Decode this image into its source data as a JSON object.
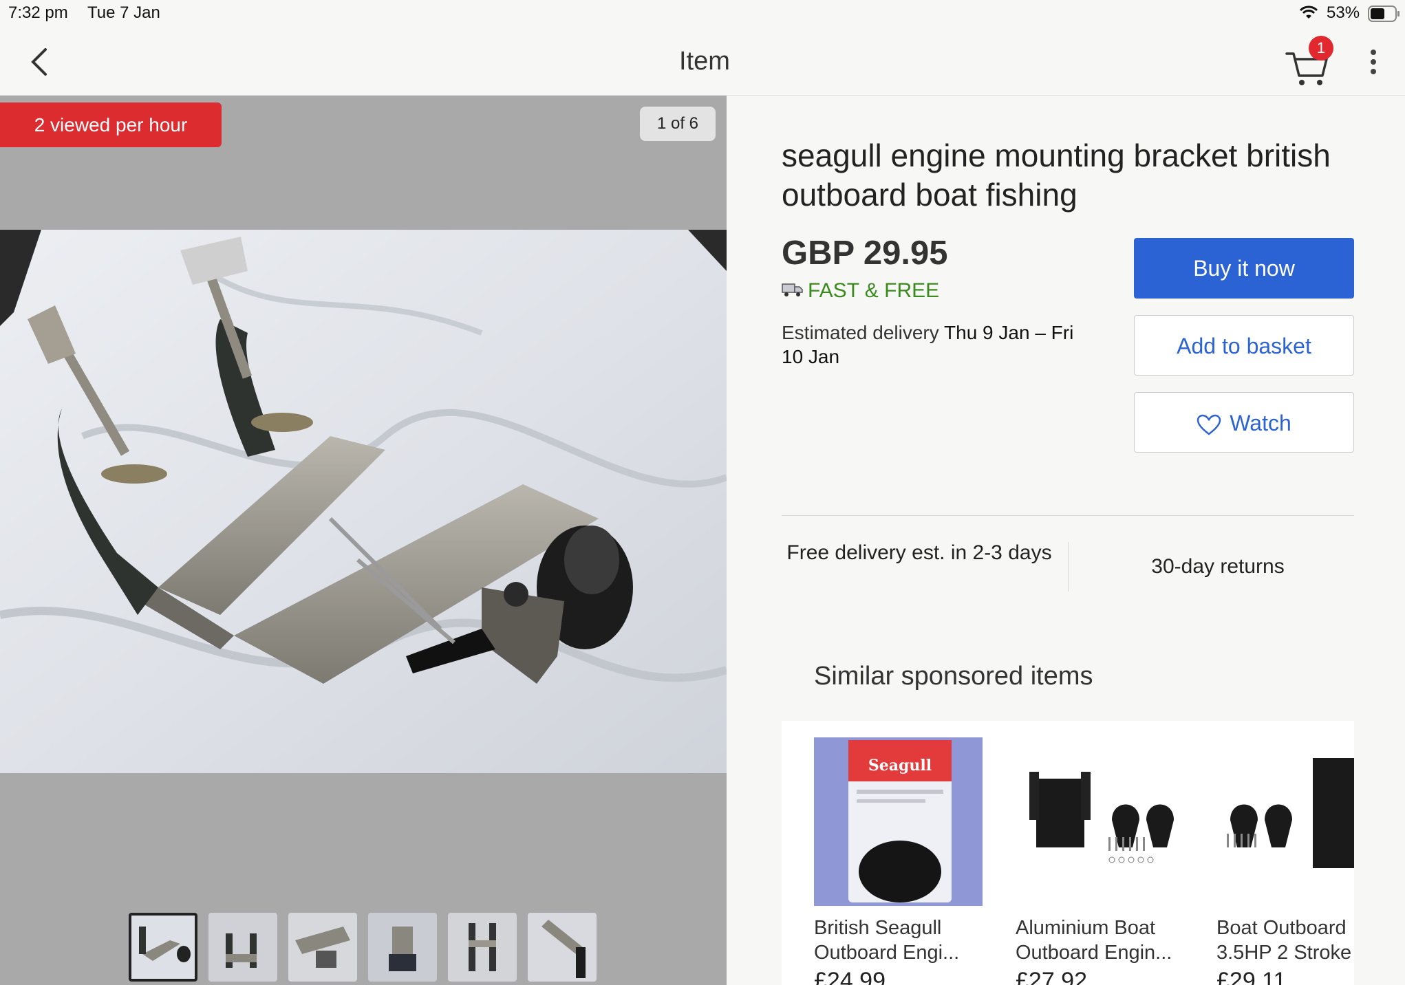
{
  "status": {
    "time": "7:32 pm",
    "date": "Tue 7 Jan",
    "battery": "53%"
  },
  "nav": {
    "title": "Item",
    "cart_count": "1"
  },
  "gallery": {
    "viewed": "2 viewed per hour",
    "counter": "1 of 6"
  },
  "item": {
    "title": "seagull engine mounting bracket british outboard boat fishing",
    "price": "GBP 29.95",
    "shipping": "FAST & FREE",
    "est_label": "Estimated delivery ",
    "est_dates": "Thu 9 Jan – Fri 10 Jan"
  },
  "buttons": {
    "buy": "Buy it now",
    "basket": "Add to basket",
    "watch": "Watch"
  },
  "features": {
    "delivery": "Free delivery est. in 2-3 days",
    "returns": "30-day returns"
  },
  "similar": {
    "heading": "Similar sponsored items",
    "items": [
      {
        "name_1": "British Seagull",
        "name_2": "Outboard  Engi...",
        "price": "£24.99",
        "pack_brand": "Seagull"
      },
      {
        "name_1": "Aluminium Boat",
        "name_2": "Outboard Engin...",
        "price": "£27.92"
      },
      {
        "name_1": "Boat Outboard",
        "name_2": "3.5HP 2 Stroke",
        "price": "£29.11"
      }
    ]
  },
  "colors": {
    "accent": "#2c63d4",
    "red": "#dd2c2f",
    "green": "#3b8a1f"
  }
}
